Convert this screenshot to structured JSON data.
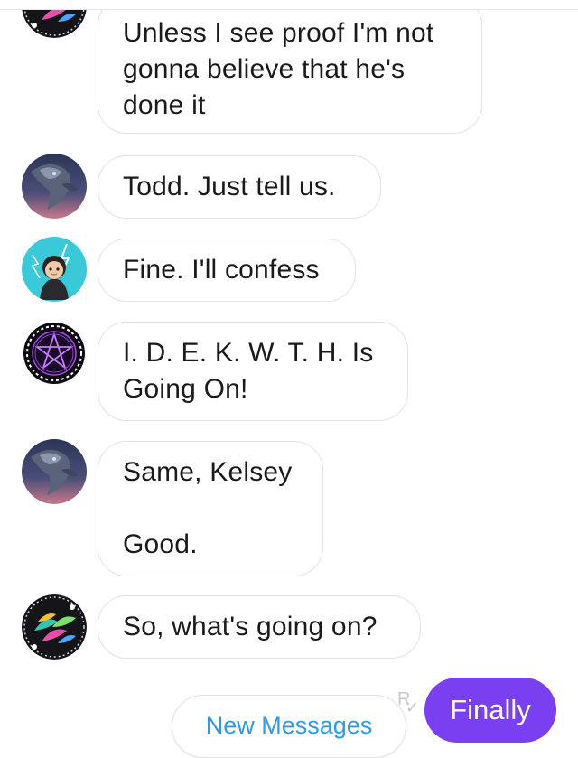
{
  "messages": [
    {
      "avatar_icon": "feather-pattern-avatar-icon",
      "lines": [
        "Unless I see proof I'm not",
        "gonna believe that he's",
        "done it"
      ]
    },
    {
      "avatar_icon": "dragon-avatar-icon",
      "lines": [
        "Todd. Just tell us."
      ]
    },
    {
      "avatar_icon": "cartoon-girl-lightning-avatar-icon",
      "lines": [
        "Fine. I'll confess"
      ]
    },
    {
      "avatar_icon": "purple-pentagram-avatar-icon",
      "lines": [
        "I. D. E. K. W. T. H. Is",
        "Going On!"
      ]
    },
    {
      "avatar_icon": "dragon-avatar-icon",
      "lines": [
        "Same, Kelsey",
        "",
        "Good."
      ]
    },
    {
      "avatar_icon": "feather-pattern-avatar-icon",
      "lines": [
        "So, what's going on?"
      ]
    }
  ],
  "new_messages_label": "New Messages",
  "read_indicator": {
    "letter": "R",
    "mark": "✓"
  },
  "sent_message": "Finally",
  "colors": {
    "accent_purple": "#7b3ff2",
    "link_blue": "#2f9be8",
    "bubble_border": "#e3e3e6",
    "text": "#1a1a1a"
  }
}
